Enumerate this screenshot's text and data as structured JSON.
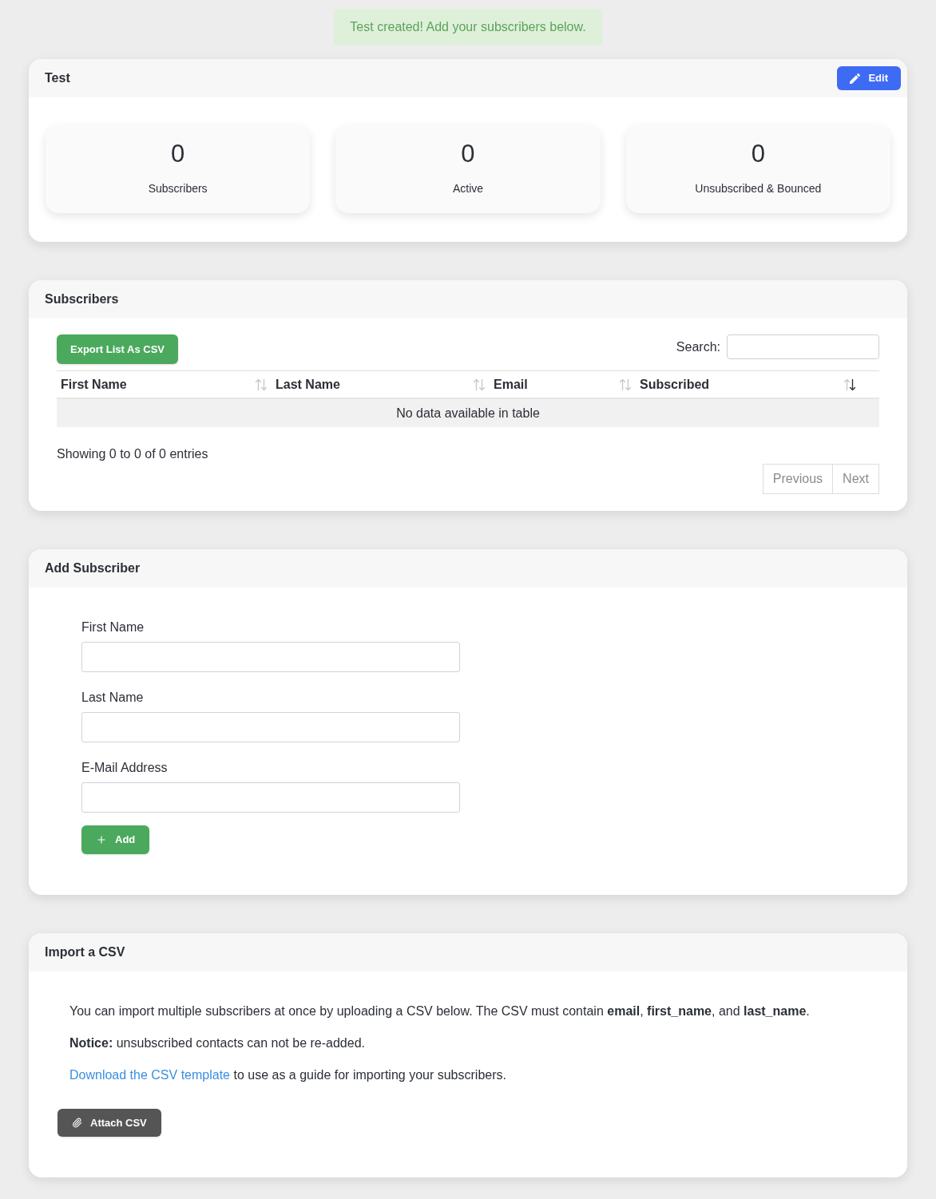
{
  "alert": {
    "text": "Test created! Add your subscribers below."
  },
  "overview": {
    "title": "Test",
    "edit_button": "Edit",
    "stats": [
      {
        "value": "0",
        "label": "Subscribers"
      },
      {
        "value": "0",
        "label": "Active"
      },
      {
        "value": "0",
        "label": "Unsubscribed & Bounced"
      }
    ]
  },
  "subscribers": {
    "title": "Subscribers",
    "export_button": "Export List As CSV",
    "search_label": "Search:",
    "table": {
      "columns": [
        {
          "label": "First Name",
          "sorted_descending": false
        },
        {
          "label": "Last Name",
          "sorted_descending": false
        },
        {
          "label": "Email",
          "sorted_descending": false
        },
        {
          "label": "Subscribed",
          "sorted_descending": true
        }
      ],
      "empty_message": "No data available in table"
    },
    "info": "Showing 0 to 0 of 0 entries",
    "pagination": [
      {
        "label": "Previous",
        "disabled": true
      },
      {
        "label": "Next",
        "disabled": true
      }
    ]
  },
  "add_subscriber": {
    "title": "Add Subscriber",
    "fields": [
      {
        "label": "First Name"
      },
      {
        "label": "Last Name"
      },
      {
        "label": "E-Mail Address"
      }
    ],
    "button": "Add"
  },
  "import_csv": {
    "title": "Import a CSV",
    "paragraphs": [
      "You can import multiple subscribers at once by uploading a CSV below. The CSV must contain **email**, **first_name**, and **last_name**.",
      "**Notice:** unsubscribed contacts can not be re-added."
    ],
    "template_link": "Download the CSV template",
    "template_text": " to use as a guide for importing your subscribers.",
    "attach_button": "Attach CSV"
  }
}
